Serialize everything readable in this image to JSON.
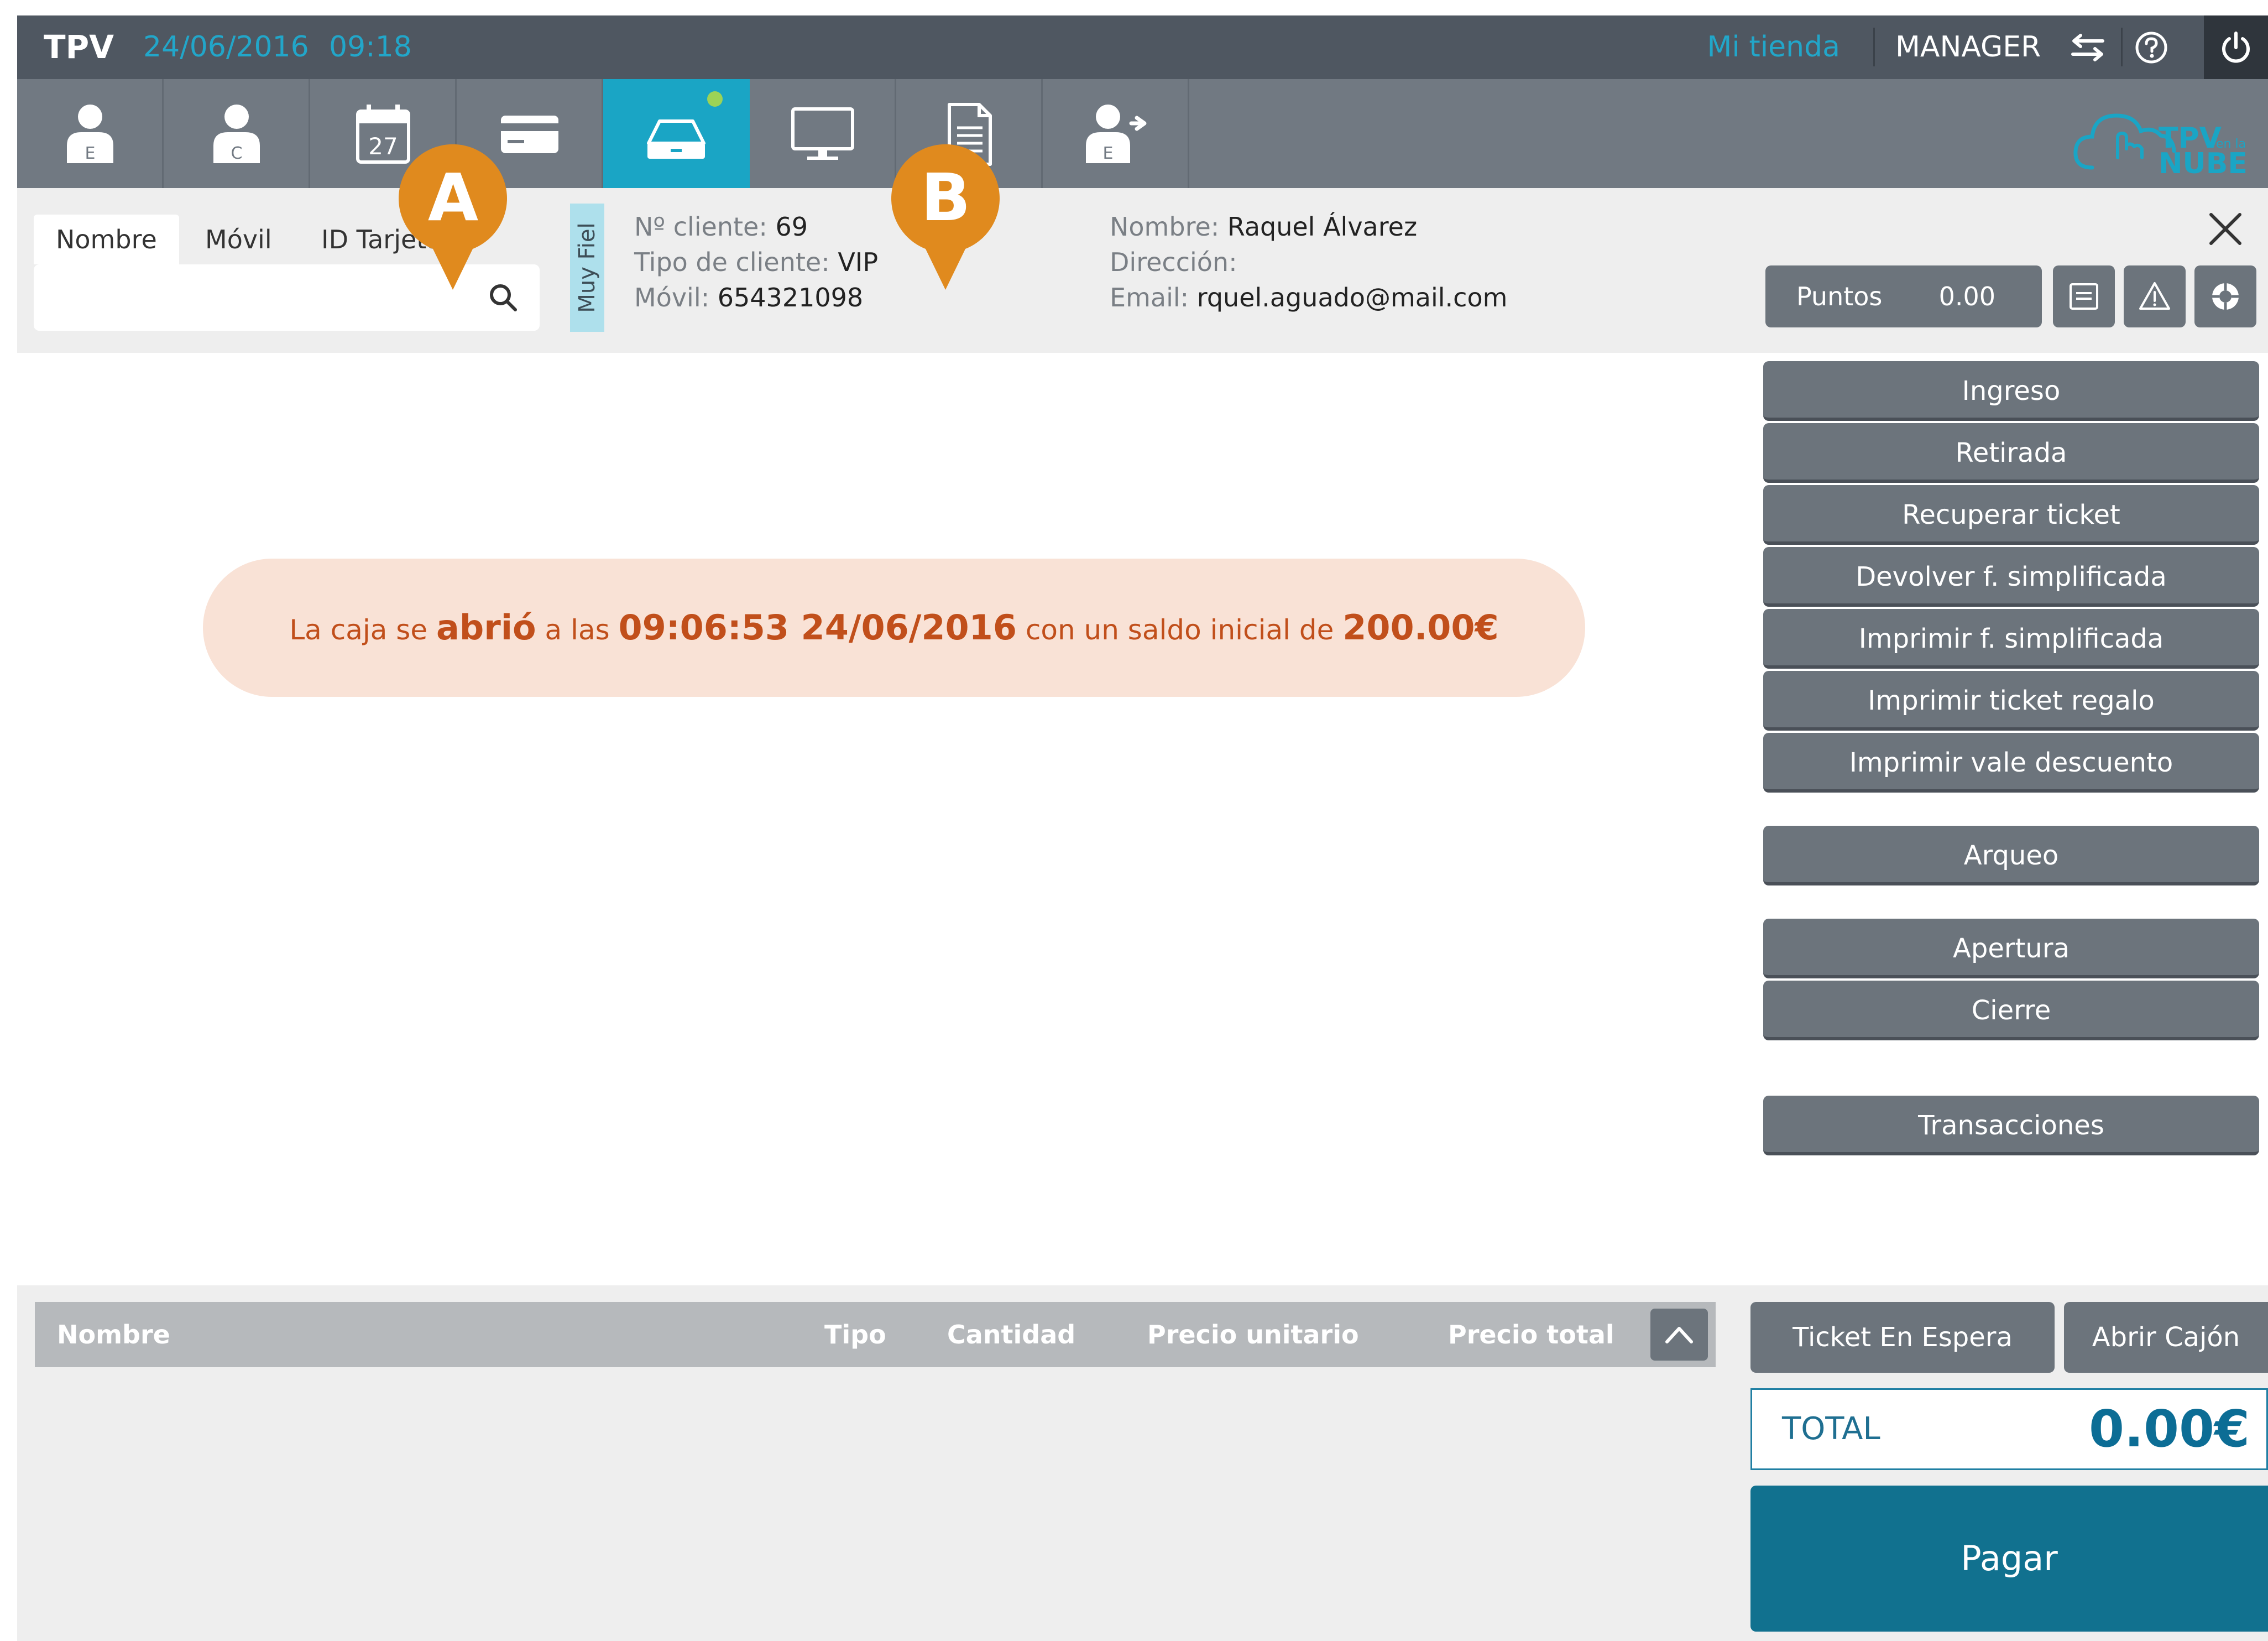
{
  "topbar": {
    "brand": "TPV",
    "date": "24/06/2016",
    "time": "09:18",
    "store": "Mi tienda",
    "user": "MANAGER"
  },
  "toolbar": {
    "icons": [
      "employee-icon",
      "customer-icon",
      "calendar-icon",
      "card-icon",
      "cash-drawer-icon",
      "monitor-icon",
      "document-icon",
      "employee-exit-icon"
    ],
    "calendar_day": "27",
    "employee_letter": "E",
    "customer_letter": "C",
    "logo_top": "TPV",
    "logo_sub": "en la",
    "logo_bottom": "NUBE",
    "active_color": "#1aa5c5"
  },
  "search": {
    "tabs": [
      "Nombre",
      "Móvil",
      "ID Tarjeta"
    ],
    "placeholder": ""
  },
  "customer": {
    "loyalty": "Muy Fiel",
    "number_label": "Nº cliente:",
    "number": "69",
    "type_label": "Tipo de cliente:",
    "type": "VIP",
    "mobile_label": "Móvil:",
    "mobile": "654321098",
    "name_label": "Nombre:",
    "name": "Raquel Álvarez",
    "address_label": "Dirección:",
    "address": "",
    "email_label": "Email:",
    "email": "rquel.aguado@mail.com",
    "points_label": "Puntos",
    "points_value": "0.00"
  },
  "markers": {
    "a": "A",
    "b": "B",
    "color": "#e08a1e"
  },
  "banner": {
    "t1": "La caja se ",
    "b1": "abrió",
    "t2": " a las ",
    "b2": "09:06:53 24/06/2016",
    "t3": " con un saldo inicial de ",
    "b3": "200.00€"
  },
  "actions": {
    "ingreso": "Ingreso",
    "retirada": "Retirada",
    "recuperar": "Recuperar ticket",
    "devolver": "Devolver f. simplificada",
    "imprimir_f": "Imprimir f. simplificada",
    "imprimir_regalo": "Imprimir ticket regalo",
    "imprimir_vale": "Imprimir vale descuento",
    "arqueo": "Arqueo",
    "apertura": "Apertura",
    "cierre": "Cierre",
    "transacciones": "Transacciones"
  },
  "table": {
    "col_nombre": "Nombre",
    "col_tipo": "Tipo",
    "col_cantidad": "Cantidad",
    "col_precio_unitario": "Precio unitario",
    "col_precio_total": "Precio total"
  },
  "checkout": {
    "ticket_espera": "Ticket En Espera",
    "abrir_cajon": "Abrir Cajón",
    "total_label": "TOTAL",
    "total_value": "0.00€",
    "pagar": "Pagar",
    "accent": "#11718f"
  }
}
